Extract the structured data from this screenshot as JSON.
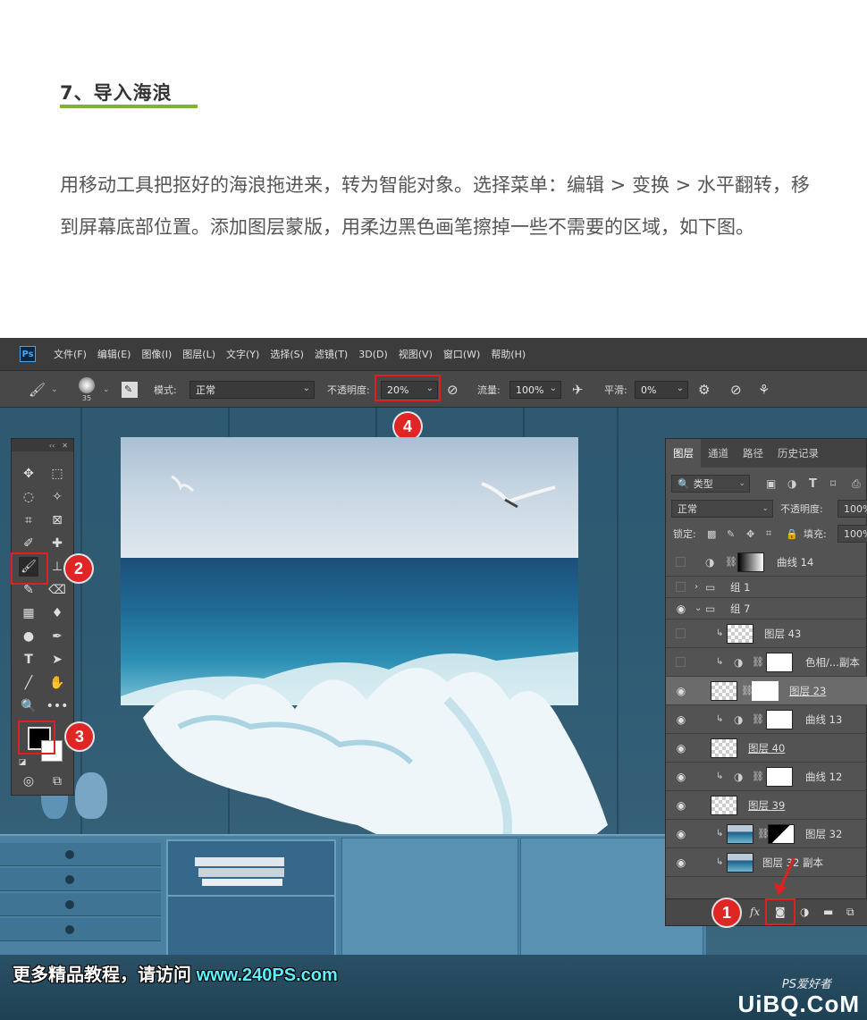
{
  "article": {
    "step_title": "7、导入海浪",
    "paragraph": "用移动工具把抠好的海浪拖进来，转为智能对象。选择菜单：编辑 > 变换 > 水平翻转，移到屏幕底部位置。添加图层蒙版，用柔边黑色画笔擦掉一些不需要的区域，如下图。"
  },
  "app": {
    "logo": "Ps",
    "menu": [
      "文件(F)",
      "编辑(E)",
      "图像(I)",
      "图层(L)",
      "文字(Y)",
      "选择(S)",
      "滤镜(T)",
      "3D(D)",
      "视图(V)",
      "窗口(W)",
      "帮助(H)"
    ]
  },
  "options_bar": {
    "brush_size": "35",
    "mode_label": "模式:",
    "mode_value": "正常",
    "opacity_label": "不透明度:",
    "opacity_value": "20%",
    "flow_label": "流量:",
    "flow_value": "100%",
    "smoothing_label": "平滑:",
    "smoothing_value": "0%"
  },
  "badges": [
    "1",
    "2",
    "3",
    "4"
  ],
  "layers_panel": {
    "tabs": [
      "图层",
      "通道",
      "路径",
      "历史记录"
    ],
    "filter_label": "类型",
    "blend_mode": "正常",
    "opacity_label": "不透明度:",
    "opacity_value": "100%",
    "lock_label": "锁定:",
    "fill_label": "填充:",
    "fill_value": "100%",
    "layers": [
      {
        "name": "曲线 14",
        "visible": false,
        "kind": "curves-grad"
      },
      {
        "name": "组 1",
        "visible": false,
        "kind": "group-closed"
      },
      {
        "name": "组 7",
        "visible": true,
        "kind": "group-open"
      },
      {
        "name": "图层 43",
        "visible": false,
        "kind": "pixel-clip"
      },
      {
        "name": "色相/...副本",
        "visible": false,
        "kind": "adj-clip"
      },
      {
        "name": "图层 23",
        "visible": true,
        "kind": "smart-mask-selected"
      },
      {
        "name": "曲线 13",
        "visible": true,
        "kind": "adj-clip"
      },
      {
        "name": "图层 40",
        "visible": true,
        "kind": "smart"
      },
      {
        "name": "曲线 12",
        "visible": true,
        "kind": "adj-clip"
      },
      {
        "name": "图层 39",
        "visible": true,
        "kind": "smart"
      },
      {
        "name": "图层 32",
        "visible": true,
        "kind": "photo-mask"
      },
      {
        "name": "图层 32 副本",
        "visible": true,
        "kind": "photo"
      }
    ],
    "bottom_fx": "fx"
  },
  "footer": {
    "banner_text": "更多精品教程，请访问 ",
    "banner_url": "www.240PS.com",
    "watermark": "UiBQ.CoM",
    "watermark_sub": "PS爱好者"
  },
  "colors": {
    "accent_green": "#7cb631",
    "highlight_red": "#e02020",
    "banner_url": "#5ff0ff"
  }
}
